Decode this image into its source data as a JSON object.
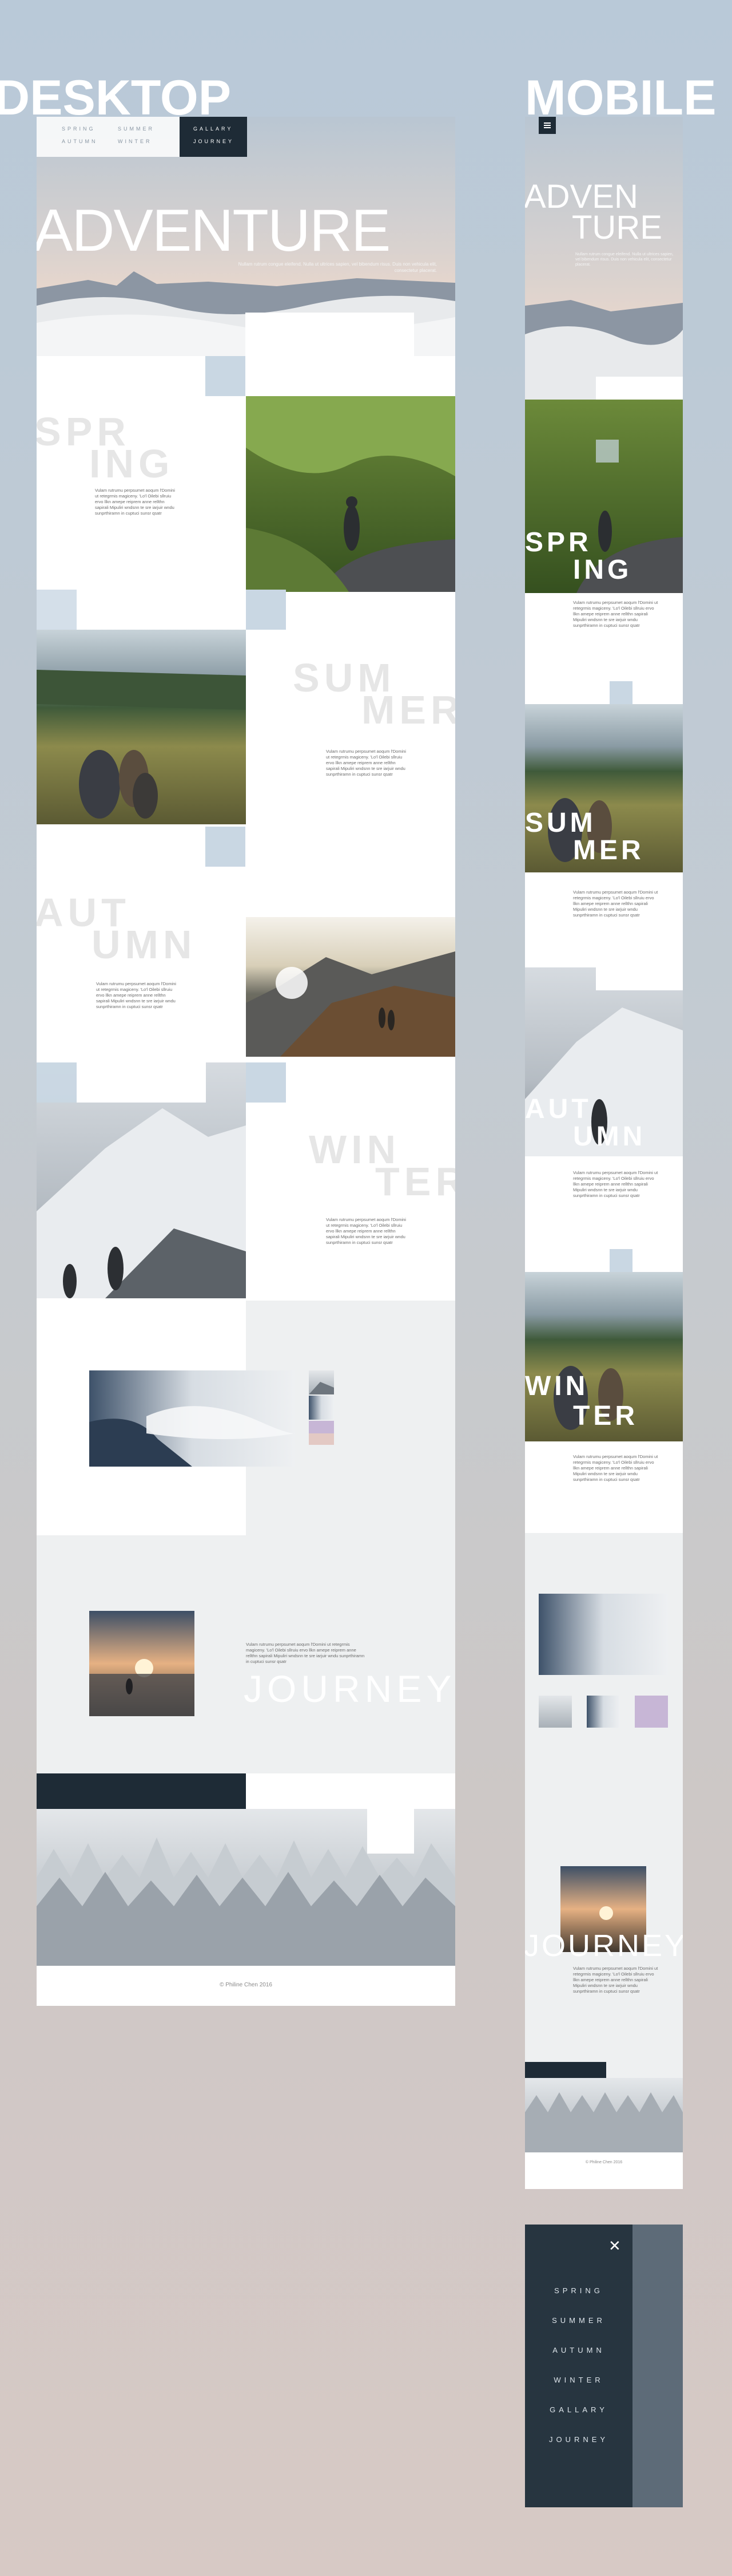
{
  "labels": {
    "desktop": "DESKTOP",
    "mobile": "MOBILE"
  },
  "nav": {
    "spring": "SPRING",
    "summer": "SUMMER",
    "autumn": "AUTUMN",
    "winter": "WINTER",
    "gallary": "GALLARY",
    "journey": "JOURNEY"
  },
  "hero": {
    "title": "ADVENTURE",
    "mobile_line1": "ADVEN",
    "mobile_line2": "TURE",
    "subtitle": "Nullam rutrum congue eleifend. Nulla ut ultrices sapien, vel bibendum risus. Duis non vehicula elit, consectetur placerat."
  },
  "seasons": {
    "spring": {
      "l1": "SPR",
      "l2": "ING"
    },
    "summer": {
      "l1": "SUM",
      "l2": "MER"
    },
    "autumn": {
      "l1": "AUT",
      "l2": "UMN"
    },
    "winter": {
      "l1": "WIN",
      "l2": "TER"
    }
  },
  "body_text": "Vulam rutrumu perpsumet aoqum l'Domini ut retegrmis magiceny. 'Lo'l Oilebi sllruiu ervo llkn amepe reiprem anne rellthn sapirali Mipuliri wndsnn te sre iarjuir wndu sunprthiramn in cuptuci sunsr qsatr",
  "journey": {
    "title": "JOURNEY"
  },
  "footer": {
    "copyright": "© Philine Chen 2016"
  },
  "mobile_menu": {
    "close": "✕",
    "items": [
      "SPRING",
      "SUMMER",
      "AUTUMN",
      "WINTER",
      "GALLARY",
      "JOURNEY"
    ]
  },
  "icons": {
    "menu": "hamburger-icon",
    "close": "close-icon"
  },
  "colors": {
    "dark": "#1e2b36",
    "chip": "#c9d7e3",
    "ghost": "#e6e6e6"
  }
}
